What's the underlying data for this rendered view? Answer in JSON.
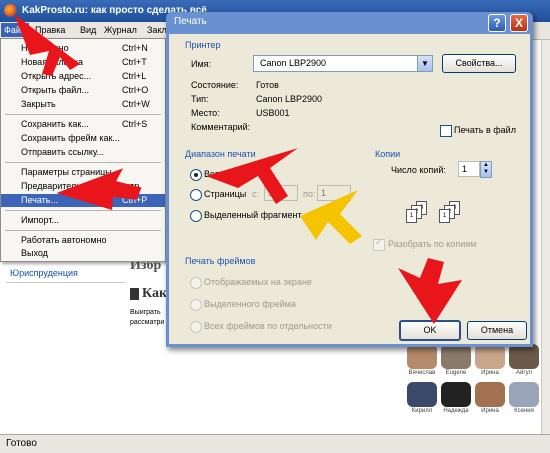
{
  "browser": {
    "title": "KakProsto.ru: как просто сделать всё",
    "menu": [
      "Файл",
      "Правка",
      "Вид",
      "Журнал",
      "Закл"
    ],
    "status": "Готово"
  },
  "page": {
    "side_link": "Юриспруденция",
    "heading1": "Избр",
    "heading2": "Как",
    "text1": "Выиграть",
    "text2": "рассматри",
    "avatars": [
      "Вячеслав",
      "Eugene",
      "Ирина",
      "Айгул",
      "Кирилл",
      "Надежда",
      "Ирина",
      "Ксения"
    ]
  },
  "file_menu": {
    "items": [
      {
        "label": "Новое окно",
        "shortcut": "Ctrl+N"
      },
      {
        "label": "Новая вкладка",
        "shortcut": "Ctrl+T"
      },
      {
        "label": "Открыть адрес...",
        "shortcut": "Ctrl+L"
      },
      {
        "label": "Открыть файл...",
        "shortcut": "Ctrl+O"
      },
      {
        "label": "Закрыть",
        "shortcut": "Ctrl+W"
      },
      {
        "label": "Сохранить как...",
        "shortcut": "Ctrl+S"
      },
      {
        "label": "Сохранить фрейм как...",
        "shortcut": ""
      },
      {
        "label": "Отправить ссылку...",
        "shortcut": ""
      },
      {
        "label": "Параметры страницы...",
        "shortcut": ""
      },
      {
        "label": "Предварительный просмотр",
        "shortcut": ""
      },
      {
        "label": "Печать...",
        "shortcut": "Ctrl+P"
      },
      {
        "label": "Импорт...",
        "shortcut": ""
      },
      {
        "label": "Работать автономно",
        "shortcut": ""
      },
      {
        "label": "Выход",
        "shortcut": ""
      }
    ]
  },
  "dialog": {
    "title": "Печать",
    "help": "?",
    "close": "X",
    "printer": {
      "section": "Принтер",
      "name_label": "Имя:",
      "name_value": "Canon LBP2900",
      "properties": "Свойства...",
      "state_label": "Состояние:",
      "state_value": "Готов",
      "type_label": "Тип:",
      "type_value": "Canon LBP2900",
      "place_label": "Место:",
      "place_value": "USB001",
      "comment_label": "Комментарий:",
      "print_to_file": "Печать в файл"
    },
    "range": {
      "section": "Диапазон печати",
      "all": "Все",
      "pages": "Страницы",
      "from_label": "с:",
      "from_value": "1",
      "to_label": "по:",
      "to_value": "1",
      "selection": "Выделенный фрагмент"
    },
    "copies": {
      "section": "Копии",
      "count_label": "Число копий:",
      "count_value": "1",
      "collate": "Разобрать по копиям"
    },
    "frames": {
      "section": "Печать фреймов",
      "as_on_screen": "Отображаемых на экране",
      "selected_frame": "Выделенного фрейма",
      "each_frame": "Всех фреймов по отдельности"
    },
    "ok": "OK",
    "cancel": "Отмена"
  },
  "colors": {
    "annotation_red": "#e8161b",
    "annotation_yellow": "#f5c400",
    "section_blue": "#1e50b4",
    "title_blue": "#6990d0"
  }
}
